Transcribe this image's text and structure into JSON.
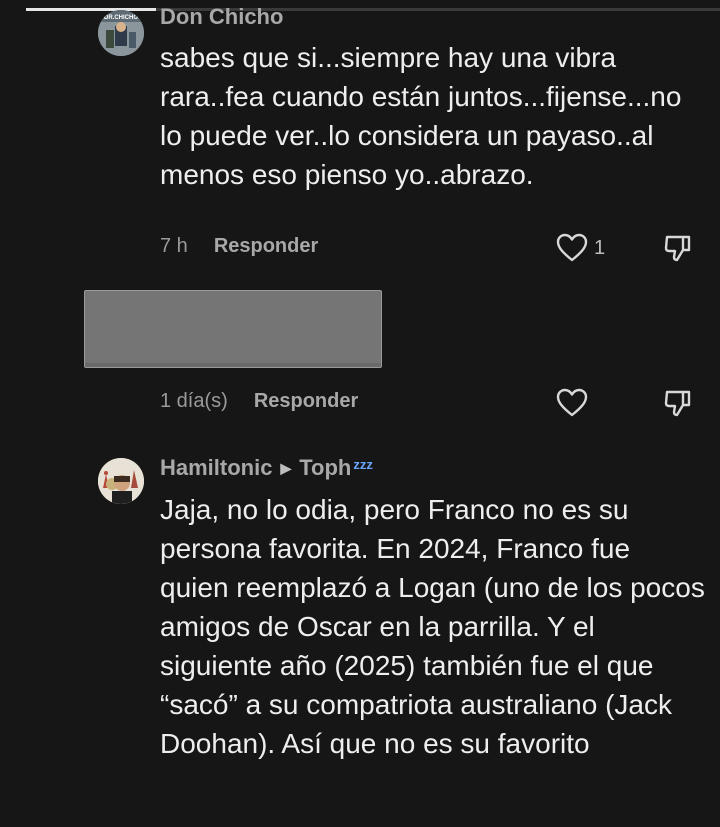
{
  "comments": [
    {
      "author": "Don Chicho",
      "avatar_text": "DR.CHICHO",
      "text": "sabes que si...siempre hay una vibra rara..fea cuando están juntos...fijense...no lo puede ver..lo considera un payaso..al menos eso pienso yo..abrazo.",
      "time": "7 h",
      "reply_label": "Responder",
      "likes": "1"
    },
    {
      "author": "",
      "text": "",
      "time": "1 día(s)",
      "reply_label": "Responder",
      "likes": ""
    },
    {
      "author": "Hamiltonic",
      "reply_to": "Toph",
      "reply_to_badge": "zzz",
      "text": "Jaja, no lo odia, pero Franco no es su persona favorita. En 2024, Franco fue quien reemplazó a Logan (uno de los pocos amigos de Oscar en la parrilla. Y el siguiente año (2025) también fue el que “sacó” a su compatriota australiano (Jack Doohan). Así que no es su favorito",
      "time": "",
      "reply_label": "",
      "likes": ""
    }
  ],
  "icons": [
    "heart-icon",
    "dislike-icon",
    "reply-arrow-icon",
    "sleep-icon"
  ],
  "colors": {
    "background": "#161616",
    "text": "#eeeeee",
    "muted": "#9a9a9a",
    "badge": "#6aa7ff"
  }
}
